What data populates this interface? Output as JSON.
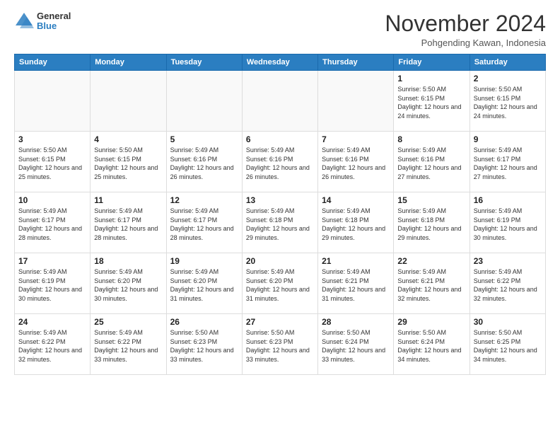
{
  "header": {
    "logo_general": "General",
    "logo_blue": "Blue",
    "month_title": "November 2024",
    "location": "Pohgending Kawan, Indonesia"
  },
  "days_of_week": [
    "Sunday",
    "Monday",
    "Tuesday",
    "Wednesday",
    "Thursday",
    "Friday",
    "Saturday"
  ],
  "weeks": [
    [
      {
        "day": "",
        "info": ""
      },
      {
        "day": "",
        "info": ""
      },
      {
        "day": "",
        "info": ""
      },
      {
        "day": "",
        "info": ""
      },
      {
        "day": "",
        "info": ""
      },
      {
        "day": "1",
        "info": "Sunrise: 5:50 AM\nSunset: 6:15 PM\nDaylight: 12 hours and 24 minutes."
      },
      {
        "day": "2",
        "info": "Sunrise: 5:50 AM\nSunset: 6:15 PM\nDaylight: 12 hours and 24 minutes."
      }
    ],
    [
      {
        "day": "3",
        "info": "Sunrise: 5:50 AM\nSunset: 6:15 PM\nDaylight: 12 hours and 25 minutes."
      },
      {
        "day": "4",
        "info": "Sunrise: 5:50 AM\nSunset: 6:15 PM\nDaylight: 12 hours and 25 minutes."
      },
      {
        "day": "5",
        "info": "Sunrise: 5:49 AM\nSunset: 6:16 PM\nDaylight: 12 hours and 26 minutes."
      },
      {
        "day": "6",
        "info": "Sunrise: 5:49 AM\nSunset: 6:16 PM\nDaylight: 12 hours and 26 minutes."
      },
      {
        "day": "7",
        "info": "Sunrise: 5:49 AM\nSunset: 6:16 PM\nDaylight: 12 hours and 26 minutes."
      },
      {
        "day": "8",
        "info": "Sunrise: 5:49 AM\nSunset: 6:16 PM\nDaylight: 12 hours and 27 minutes."
      },
      {
        "day": "9",
        "info": "Sunrise: 5:49 AM\nSunset: 6:17 PM\nDaylight: 12 hours and 27 minutes."
      }
    ],
    [
      {
        "day": "10",
        "info": "Sunrise: 5:49 AM\nSunset: 6:17 PM\nDaylight: 12 hours and 28 minutes."
      },
      {
        "day": "11",
        "info": "Sunrise: 5:49 AM\nSunset: 6:17 PM\nDaylight: 12 hours and 28 minutes."
      },
      {
        "day": "12",
        "info": "Sunrise: 5:49 AM\nSunset: 6:17 PM\nDaylight: 12 hours and 28 minutes."
      },
      {
        "day": "13",
        "info": "Sunrise: 5:49 AM\nSunset: 6:18 PM\nDaylight: 12 hours and 29 minutes."
      },
      {
        "day": "14",
        "info": "Sunrise: 5:49 AM\nSunset: 6:18 PM\nDaylight: 12 hours and 29 minutes."
      },
      {
        "day": "15",
        "info": "Sunrise: 5:49 AM\nSunset: 6:18 PM\nDaylight: 12 hours and 29 minutes."
      },
      {
        "day": "16",
        "info": "Sunrise: 5:49 AM\nSunset: 6:19 PM\nDaylight: 12 hours and 30 minutes."
      }
    ],
    [
      {
        "day": "17",
        "info": "Sunrise: 5:49 AM\nSunset: 6:19 PM\nDaylight: 12 hours and 30 minutes."
      },
      {
        "day": "18",
        "info": "Sunrise: 5:49 AM\nSunset: 6:20 PM\nDaylight: 12 hours and 30 minutes."
      },
      {
        "day": "19",
        "info": "Sunrise: 5:49 AM\nSunset: 6:20 PM\nDaylight: 12 hours and 31 minutes."
      },
      {
        "day": "20",
        "info": "Sunrise: 5:49 AM\nSunset: 6:20 PM\nDaylight: 12 hours and 31 minutes."
      },
      {
        "day": "21",
        "info": "Sunrise: 5:49 AM\nSunset: 6:21 PM\nDaylight: 12 hours and 31 minutes."
      },
      {
        "day": "22",
        "info": "Sunrise: 5:49 AM\nSunset: 6:21 PM\nDaylight: 12 hours and 32 minutes."
      },
      {
        "day": "23",
        "info": "Sunrise: 5:49 AM\nSunset: 6:22 PM\nDaylight: 12 hours and 32 minutes."
      }
    ],
    [
      {
        "day": "24",
        "info": "Sunrise: 5:49 AM\nSunset: 6:22 PM\nDaylight: 12 hours and 32 minutes."
      },
      {
        "day": "25",
        "info": "Sunrise: 5:49 AM\nSunset: 6:22 PM\nDaylight: 12 hours and 33 minutes."
      },
      {
        "day": "26",
        "info": "Sunrise: 5:50 AM\nSunset: 6:23 PM\nDaylight: 12 hours and 33 minutes."
      },
      {
        "day": "27",
        "info": "Sunrise: 5:50 AM\nSunset: 6:23 PM\nDaylight: 12 hours and 33 minutes."
      },
      {
        "day": "28",
        "info": "Sunrise: 5:50 AM\nSunset: 6:24 PM\nDaylight: 12 hours and 33 minutes."
      },
      {
        "day": "29",
        "info": "Sunrise: 5:50 AM\nSunset: 6:24 PM\nDaylight: 12 hours and 34 minutes."
      },
      {
        "day": "30",
        "info": "Sunrise: 5:50 AM\nSunset: 6:25 PM\nDaylight: 12 hours and 34 minutes."
      }
    ]
  ]
}
